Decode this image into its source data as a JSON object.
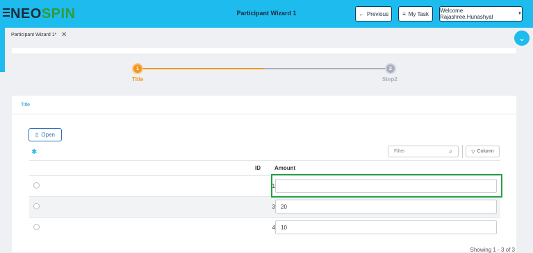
{
  "header": {
    "logo_part1": "NEO",
    "logo_part2": "SPIN",
    "app_title": "Participant Wizard 1",
    "previous_label": "Previous",
    "mytask_label": "My Task",
    "welcome_label": "Welcome Rajashree.Hunashyal"
  },
  "tabs": {
    "active_label": "Participant Wizard 1*"
  },
  "stepper": {
    "steps": [
      {
        "number": "1",
        "label": "Title",
        "state": "active"
      },
      {
        "number": "2",
        "label": "Step2",
        "state": "pending"
      }
    ]
  },
  "panel": {
    "title": "Title",
    "open_label": "Open",
    "filter_placeholder": "Filter",
    "column_label": "Column",
    "columns": [
      "ID",
      "Amount"
    ],
    "rows": [
      {
        "id": "1",
        "amount": ""
      },
      {
        "id": "3",
        "amount": "20"
      },
      {
        "id": "4",
        "amount": "10"
      }
    ],
    "footer": "Showing 1 - 3 of 3"
  },
  "colors": {
    "accent": "#1ebbee",
    "active_step": "#f0971f",
    "highlight": "#22a340",
    "brand_green": "#2e9d3b"
  }
}
